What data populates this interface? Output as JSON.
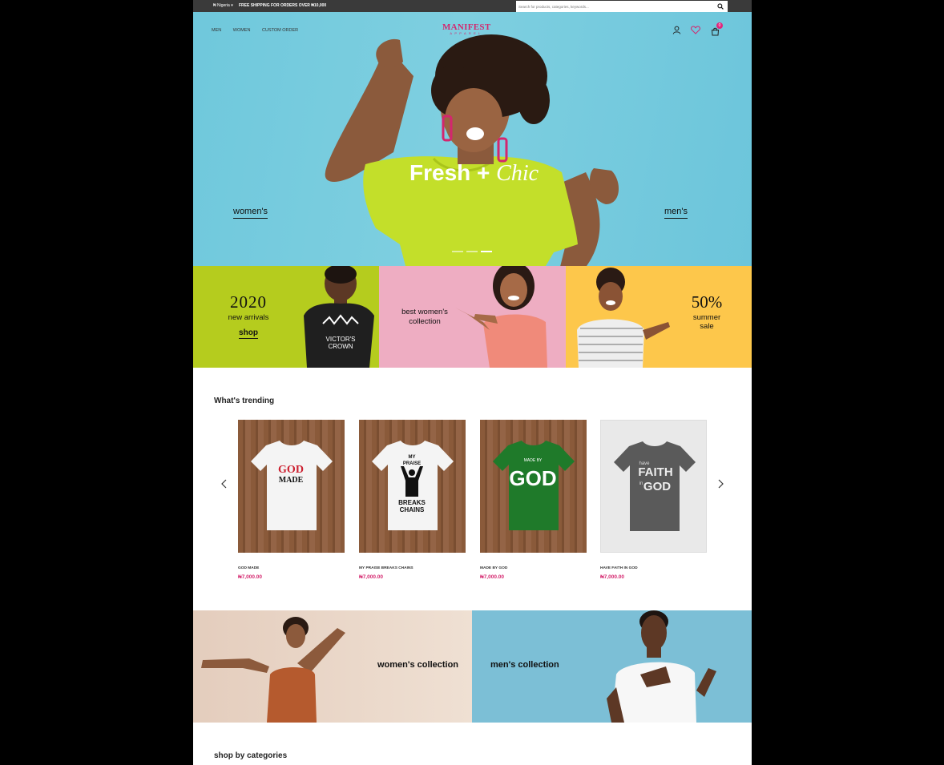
{
  "topbar": {
    "region": "₦ Nigeria ▾",
    "shipping": "FREE SHIPPING FOR ORDERS OVER ₦10,000",
    "search_placeholder": "Search for products, categories, keywords..."
  },
  "nav": {
    "items": [
      "MEN",
      "WOMEN",
      "CUSTOM ORDER"
    ]
  },
  "logo": {
    "line1": "MANIFEST",
    "line2": "APPAREL"
  },
  "header_icons": [
    "user-icon",
    "heart-icon",
    "cart-icon"
  ],
  "cart_count": "0",
  "hero": {
    "title_bold": "Fresh +",
    "title_script": "Chic",
    "left_link": "women's",
    "right_link": "men's",
    "slides": 3,
    "active_slide": 3
  },
  "promos": [
    {
      "big": "2020",
      "line": "new arrivals",
      "link": "shop",
      "bg": "#b5cc1e"
    },
    {
      "line1": "best women's",
      "line2": "collection",
      "bg": "#eeadc2"
    },
    {
      "big": "50%",
      "line1": "summer",
      "line2": "sale",
      "bg": "#fdc74b"
    }
  ],
  "trending": {
    "title": "What's trending",
    "products": [
      {
        "name": "GOD MADE",
        "price": "₦7,000.00",
        "shirt_text": [
          "GOD",
          "MADE"
        ],
        "shirt_color": "#f4f4f4"
      },
      {
        "name": "MY PRAISE BREAKS CHAINS",
        "price": "₦7,000.00",
        "shirt_text": [
          "MY",
          "PRAISE",
          "BREAKS",
          "CHAINS"
        ],
        "shirt_color": "#f4f4f4"
      },
      {
        "name": "MADE BY GOD",
        "price": "₦7,000.00",
        "shirt_text": [
          "MADE BY",
          "GOD"
        ],
        "shirt_color": "#1f7a2a"
      },
      {
        "name": "HAVE FAITH IN GOD",
        "price": "₦7,000.00",
        "shirt_text": [
          "have",
          "FAITH",
          "in",
          "GOD"
        ],
        "shirt_color": "#5a5a5a"
      }
    ]
  },
  "collections": [
    {
      "label": "women's collection",
      "bg": "#ead7c8"
    },
    {
      "label": "men's collection",
      "bg": "#7cbfd6"
    }
  ],
  "categories": {
    "title": "shop by categories"
  },
  "shirt2": {
    "chest": "VICTOR'S",
    "chest2": "CROWN"
  },
  "colors": {
    "accent": "#d4266e",
    "topbar": "#3a3a3a",
    "hero": "#74cade"
  }
}
